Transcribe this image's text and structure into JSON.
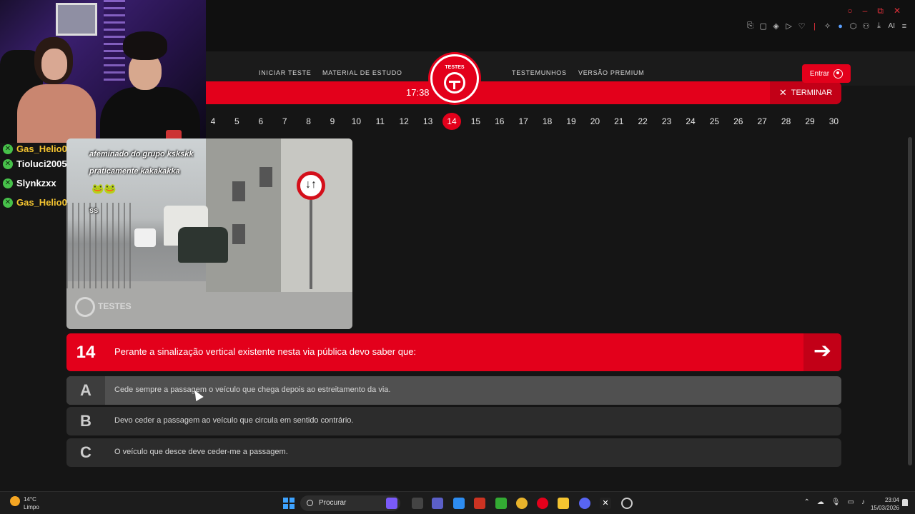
{
  "window": {
    "controls": [
      "○",
      "–",
      "⧉",
      "✕"
    ],
    "toolbar_icons": [
      "⎘",
      "▢",
      "◈",
      "▷",
      "♡",
      "✧",
      "●",
      "⬡",
      "⚇",
      "⤓",
      "◌"
    ],
    "toolbar_ai_label": "AI"
  },
  "chat": {
    "users": [
      {
        "name": "Gas_Helio0",
        "color": "#f4c430"
      },
      {
        "name": "Tioluci2005",
        "color": "#ffffff"
      },
      {
        "name": "Slynkzxx",
        "color": "#ffffff"
      },
      {
        "name": "Gas_Helio0",
        "color": "#f4c430"
      }
    ],
    "messages": [
      "afeminado do grupo kskskk",
      "praticamente kakakakka",
      "ss"
    ]
  },
  "nav": {
    "links": [
      "INICIAR TESTE",
      "MATERIAL DE ESTUDO",
      "TESTEMUNHOS",
      "VERSÃO PREMIUM"
    ],
    "logo_text": "TESTES",
    "login_label": "Entrar"
  },
  "quiz": {
    "timer": "17:38",
    "finish_label": "TERMINAR",
    "question_numbers": [
      "4",
      "5",
      "6",
      "7",
      "8",
      "9",
      "10",
      "11",
      "12",
      "13",
      "14",
      "15",
      "16",
      "17",
      "18",
      "19",
      "20",
      "21",
      "22",
      "23",
      "24",
      "25",
      "26",
      "27",
      "28",
      "29",
      "30"
    ],
    "current_question": "14",
    "question_text": "Perante a sinalização vertical existente nesta via pública devo saber que:",
    "next_icon": "arrow-right-icon",
    "image_watermark": "TESTES",
    "answers": [
      {
        "letter": "A",
        "text": "Cede sempre a passagem o veículo que chega depois ao estreitamento da via."
      },
      {
        "letter": "B",
        "text": "Devo ceder a passagem ao veículo que circula em sentido contrário."
      },
      {
        "letter": "C",
        "text": "O veículo que desce deve ceder-me a passagem."
      }
    ]
  },
  "taskbar": {
    "weather_temp": "14°C",
    "weather_desc": "Limpo",
    "search_placeholder": "Procurar",
    "time": "23:04",
    "date": "15/03/2026"
  },
  "colors": {
    "brand_red": "#e3001b",
    "background": "#151515"
  }
}
